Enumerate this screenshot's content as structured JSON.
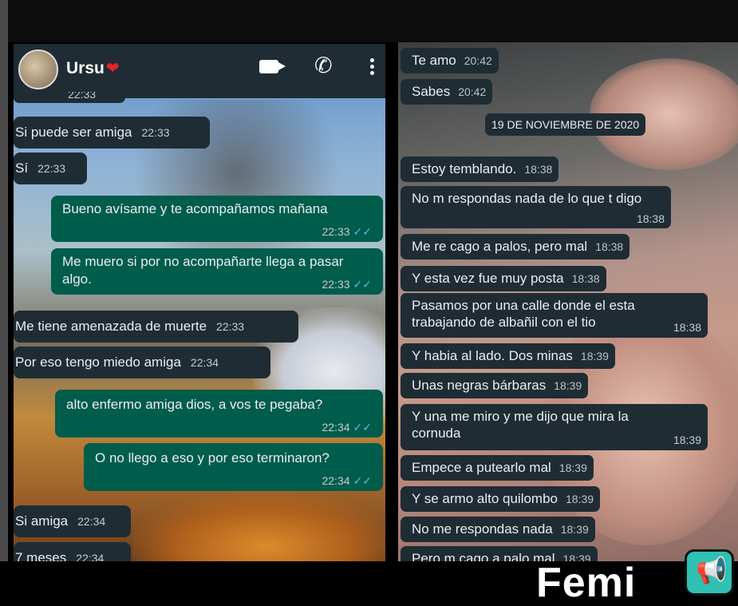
{
  "left_chat": {
    "contact_name": "Ursu",
    "heart": "❤",
    "partial_top_time": "22:33",
    "messages": [
      {
        "dir": "in",
        "text": "Si puede ser amiga",
        "time": "22:33"
      },
      {
        "dir": "in",
        "text": "Sí",
        "time": "22:33"
      },
      {
        "dir": "out",
        "text": "Bueno avísame y te acompañamos mañana",
        "time": "22:33"
      },
      {
        "dir": "out",
        "text": "Me muero si por no acompañarte llega a pasar algo.",
        "time": "22:33"
      },
      {
        "dir": "in",
        "text": "Me tiene amenazada de muerte",
        "time": "22:33"
      },
      {
        "dir": "in",
        "text": "Por eso tengo miedo amiga",
        "time": "22:34"
      },
      {
        "dir": "out",
        "text": "alto enfermo amiga dios, a vos te pegaba?",
        "time": "22:34"
      },
      {
        "dir": "out",
        "text": "O no llego a eso y por eso terminaron?",
        "time": "22:34"
      },
      {
        "dir": "in",
        "text": "Si amiga",
        "time": "22:34"
      },
      {
        "dir": "in",
        "text": "7 meses",
        "time": "22:34"
      }
    ]
  },
  "right_chat": {
    "date_separator": "19 DE NOVIEMBRE DE 2020",
    "messages": [
      {
        "text": "Te amo",
        "time": "20:42"
      },
      {
        "text": "Sabes",
        "time": "20:42"
      },
      {
        "text": "Estoy temblando.",
        "time": "18:38"
      },
      {
        "text": "No m respondas nada de lo que t digo",
        "time": "18:38"
      },
      {
        "text": "Me re cago a palos, pero mal",
        "time": "18:38"
      },
      {
        "text": "Y esta vez fue muy posta",
        "time": "18:38"
      },
      {
        "text": "Pasamos por una calle donde el esta trabajando de albañil con el tio",
        "time": "18:38"
      },
      {
        "text": "Y habia al lado. Dos minas",
        "time": "18:39"
      },
      {
        "text": "Unas negras bárbaras",
        "time": "18:39"
      },
      {
        "text": "Y una me miro y me dijo que mira la cornuda",
        "time": "18:39"
      },
      {
        "text": "Empece a putearlo mal",
        "time": "18:39"
      },
      {
        "text": "Y se armo alto quilombo",
        "time": "18:39"
      },
      {
        "text": "No me respondas nada",
        "time": "18:39"
      },
      {
        "text": "Pero m cago a palo mal",
        "time": "18:39"
      }
    ]
  },
  "brand": {
    "name": "Femi",
    "icon": "megaphone-icon"
  },
  "icons": {
    "video": "video-call-icon",
    "phone": "phone-icon",
    "menu": "more-vert-icon",
    "read_receipt": "double-check-icon"
  },
  "colors": {
    "incoming_bubble": "#1f2c34",
    "outgoing_bubble": "#005c4b",
    "header": "#1f2c34",
    "read_tick": "#53bdeb",
    "brand_icon_bg": "#2fc1b3"
  }
}
